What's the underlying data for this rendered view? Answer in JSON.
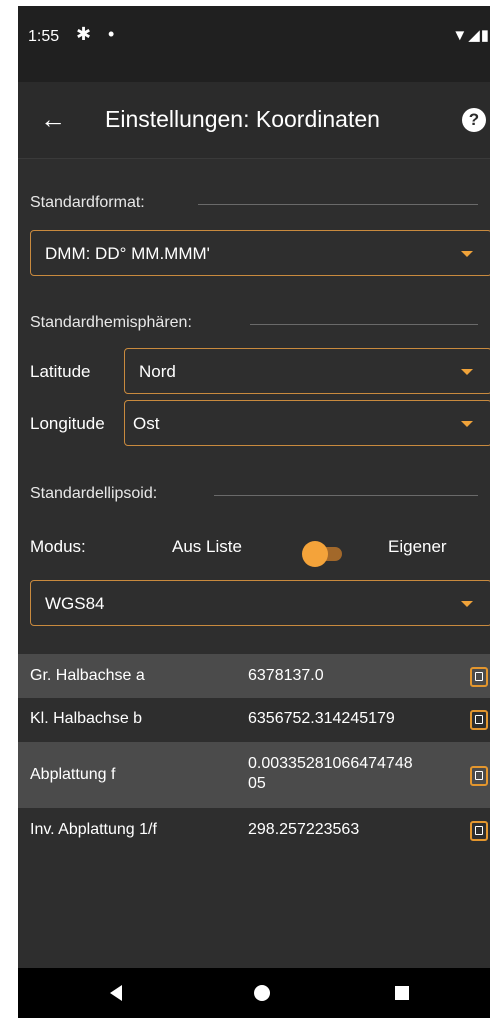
{
  "status_bar": {
    "time": "1:55",
    "settings_icon": "gear-icon",
    "notification_dot": "•",
    "system_icons": "▼◢▮"
  },
  "app_bar": {
    "title": "Einstellungen: Koordinaten",
    "back_icon": "←",
    "help_icon": "?"
  },
  "standard_format": {
    "label": "Standardformat:",
    "value": "DMM: DD° MM.MMM'"
  },
  "standard_hemispheres": {
    "label": "Standardhemisphären:",
    "latitude_label": "Latitude",
    "latitude_value": "Nord",
    "longitude_label": "Longitude",
    "longitude_value": "Ost"
  },
  "standard_ellipsoid": {
    "label": "Standardellipsoid:",
    "mode_label": "Modus:",
    "option_left": "Aus Liste",
    "option_right": "Eigener",
    "toggle_on": false,
    "ellipsoid_value": "WGS84"
  },
  "parameters": [
    {
      "name": "Gr. Halbachse a",
      "value": "6378137.0"
    },
    {
      "name": "Kl. Halbachse b",
      "value": "6356752.314245179"
    },
    {
      "name": "Abplattung f",
      "value": "0.00335281066474748\n05"
    },
    {
      "name": "Inv. Abplattung 1/f",
      "value": "298.257223563"
    }
  ],
  "colors": {
    "accent": "#f4a33a",
    "background": "#2e2e2e",
    "row_shade": "#4b4b4b"
  }
}
